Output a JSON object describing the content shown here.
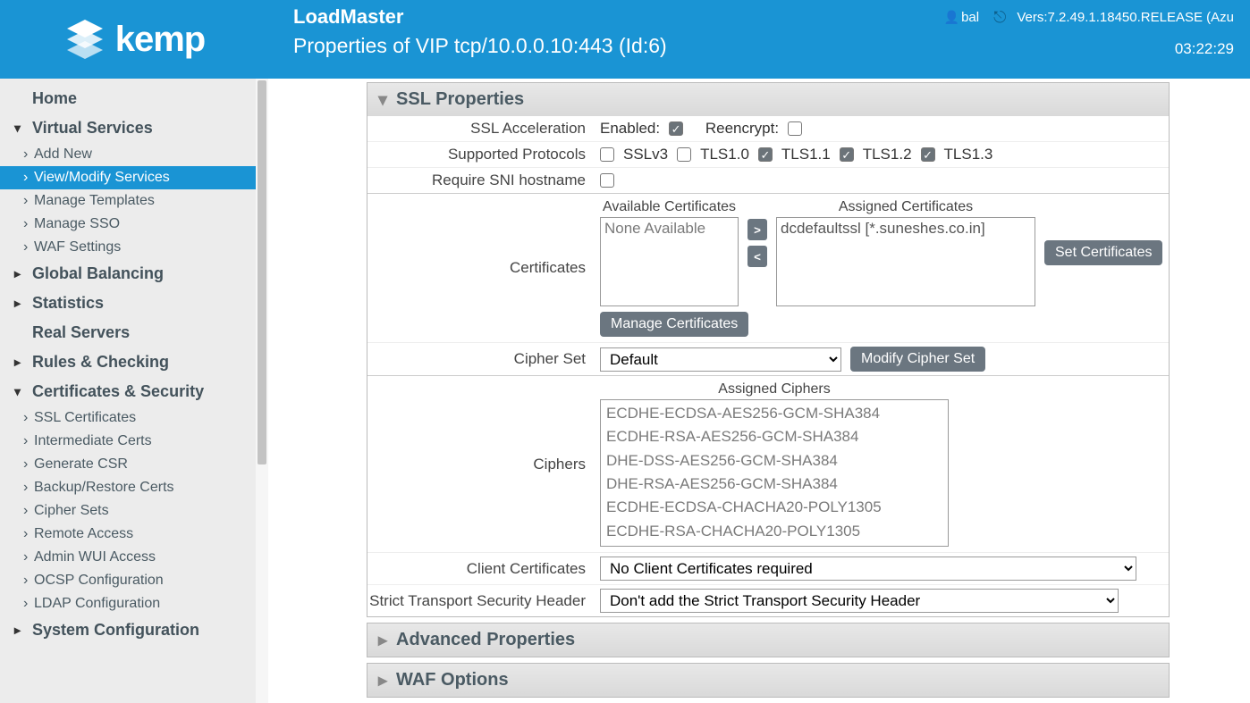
{
  "header": {
    "app_title": "LoadMaster",
    "page_title": "Properties of VIP tcp/10.0.0.10:443 (Id:6)",
    "user": "bal",
    "version": "Vers:7.2.49.1.18450.RELEASE (Azu",
    "time": "03:22:29"
  },
  "logo": {
    "text": "kemp"
  },
  "sidebar": {
    "home": "Home",
    "virtual_services": "Virtual Services",
    "vs_add_new": "Add New",
    "vs_view_modify": "View/Modify Services",
    "vs_manage_templates": "Manage Templates",
    "vs_manage_sso": "Manage SSO",
    "vs_waf_settings": "WAF Settings",
    "global_balancing": "Global Balancing",
    "statistics": "Statistics",
    "real_servers": "Real Servers",
    "rules_checking": "Rules & Checking",
    "certs_security": "Certificates & Security",
    "cs_ssl_certs": "SSL Certificates",
    "cs_intermediate": "Intermediate Certs",
    "cs_generate_csr": "Generate CSR",
    "cs_backup_restore": "Backup/Restore Certs",
    "cs_cipher_sets": "Cipher Sets",
    "cs_remote_access": "Remote Access",
    "cs_admin_wui": "Admin WUI Access",
    "cs_ocsp": "OCSP Configuration",
    "cs_ldap": "LDAP Configuration",
    "system_config": "System Configuration"
  },
  "ssl": {
    "panel_title": "SSL Properties",
    "accel_label": "SSL Acceleration",
    "enabled_label": "Enabled:",
    "reencrypt_label": "Reencrypt:",
    "protocols_label": "Supported Protocols",
    "proto_sslv3": "SSLv3",
    "proto_tls10": "TLS1.0",
    "proto_tls11": "TLS1.1",
    "proto_tls12": "TLS1.2",
    "proto_tls13": "TLS1.3",
    "require_sni_label": "Require SNI hostname",
    "certificates_label": "Certificates",
    "available_title": "Available Certificates",
    "assigned_title": "Assigned Certificates",
    "available_none": "None Available",
    "assigned_cert": "dcdefaultssl [*.suneshes.co.in]",
    "set_certs_btn": "Set Certificates",
    "manage_certs_btn": "Manage Certificates",
    "cipher_set_label": "Cipher Set",
    "cipher_set_value": "Default",
    "modify_cipher_btn": "Modify Cipher Set",
    "ciphers_label": "Ciphers",
    "assigned_ciphers_title": "Assigned Ciphers",
    "cipher_1": "ECDHE-ECDSA-AES256-GCM-SHA384",
    "cipher_2": "ECDHE-RSA-AES256-GCM-SHA384",
    "cipher_3": "DHE-DSS-AES256-GCM-SHA384",
    "cipher_4": "DHE-RSA-AES256-GCM-SHA384",
    "cipher_5": "ECDHE-ECDSA-CHACHA20-POLY1305",
    "cipher_6": "ECDHE-RSA-CHACHA20-POLY1305",
    "client_certs_label": "Client Certificates",
    "client_certs_value": "No Client Certificates required",
    "hsts_label": "Strict Transport Security Header",
    "hsts_value": "Don't add the Strict Transport Security Header"
  },
  "advanced": {
    "title": "Advanced Properties"
  },
  "waf": {
    "title": "WAF Options"
  }
}
